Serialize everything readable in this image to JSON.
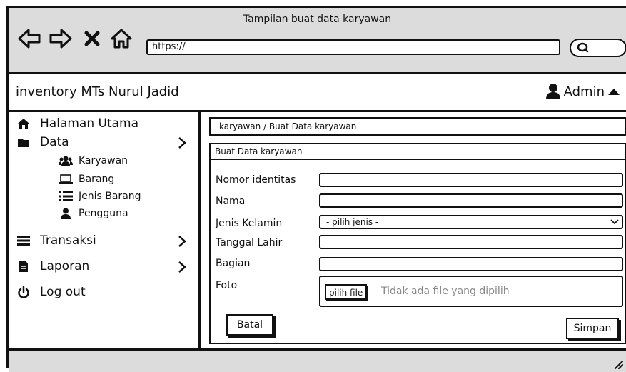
{
  "window": {
    "title": "Tampilan buat data karyawan"
  },
  "browser": {
    "url": "https://"
  },
  "header": {
    "app_title": "inventory MTs Nurul Jadid",
    "user_label": "Admin"
  },
  "sidebar": {
    "items": [
      {
        "label": "Halaman Utama",
        "icon": "home-icon"
      },
      {
        "label": "Data",
        "icon": "folder-icon"
      },
      {
        "label": "Transaksi",
        "icon": "list-icon"
      },
      {
        "label": "Laporan",
        "icon": "file-icon"
      },
      {
        "label": "Log out",
        "icon": "power-icon"
      }
    ],
    "sub_items": [
      {
        "label": "Karyawan",
        "icon": "users-icon"
      },
      {
        "label": "Barang",
        "icon": "laptop-icon"
      },
      {
        "label": "Jenis Barang",
        "icon": "list-icon"
      },
      {
        "label": "Pengguna",
        "icon": "user-icon"
      }
    ]
  },
  "breadcrumb": "karyawan / Buat Data karyawan",
  "form": {
    "title": "Buat Data karyawan",
    "fields": {
      "nomor_identitas": "Nomor identitas",
      "nama": "Nama",
      "jenis_kelamin": "Jenis Kelamin",
      "tanggal_lahir": "Tanggal Lahir",
      "bagian": "Bagian",
      "foto": "Foto"
    },
    "jenis_kelamin_selected": "-  pilih jenis -",
    "file_button": "pilih file",
    "file_status": "Tidak ada file yang dipilih",
    "cancel_label": "Batal",
    "save_label": "Simpan"
  }
}
